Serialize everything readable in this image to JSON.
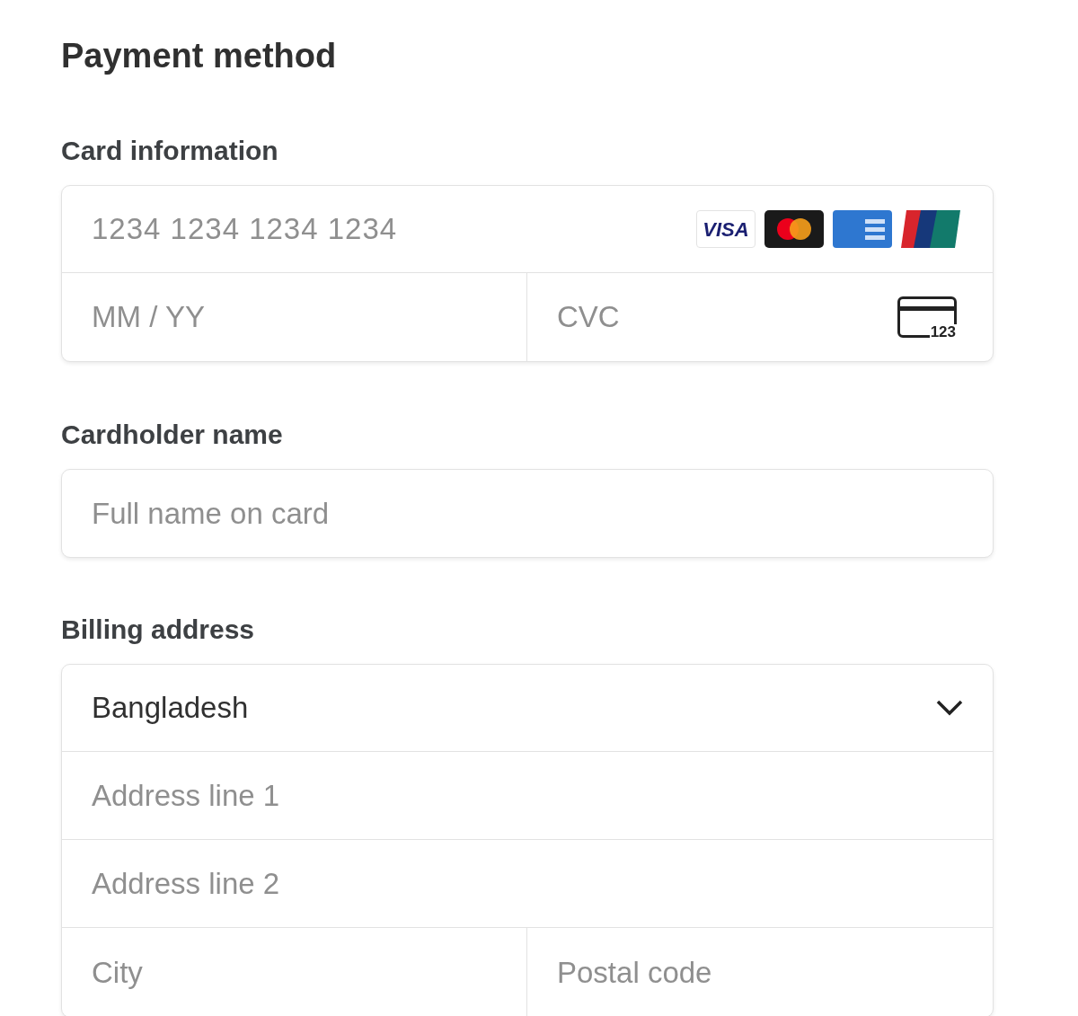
{
  "title": "Payment method",
  "card_information": {
    "label": "Card information",
    "number_placeholder": "1234 1234 1234 1234",
    "brands": [
      {
        "kind": "visa",
        "text": "VISA"
      },
      {
        "kind": "mastercard"
      },
      {
        "kind": "amex"
      },
      {
        "kind": "unionpay"
      }
    ],
    "expiry_placeholder": "MM / YY",
    "cvc_placeholder": "CVC",
    "cvc_icon_text": "123"
  },
  "cardholder": {
    "label": "Cardholder name",
    "placeholder": "Full name on card"
  },
  "billing_address": {
    "label": "Billing address",
    "country": "Bangladesh",
    "address_line_1_placeholder": "Address line 1",
    "address_line_2_placeholder": "Address line 2",
    "city_placeholder": "City",
    "postal_code_placeholder": "Postal code"
  }
}
